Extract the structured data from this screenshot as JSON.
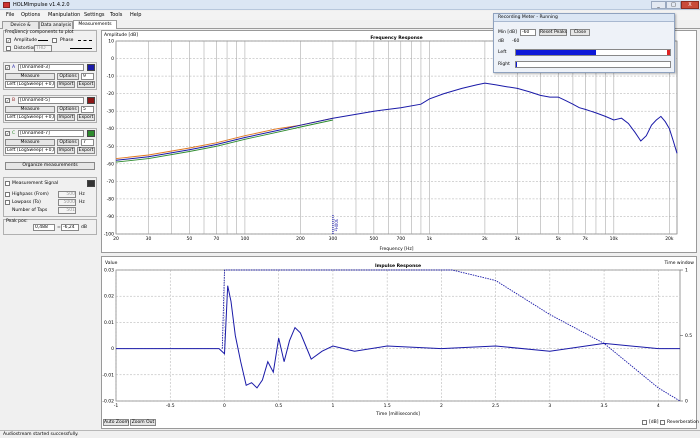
{
  "app": {
    "title": "HOLMImpulse v1.4.2.0",
    "win_min": "_",
    "win_max": "□",
    "win_close": "X"
  },
  "menu": [
    "File",
    "Options",
    "Manipulation",
    "Settings",
    "Tools",
    "Help"
  ],
  "tabs": [
    "Device & Signal",
    "Data analysis",
    "Measurements"
  ],
  "left": {
    "freq_group_title": "Frequency components to plot",
    "amplitude": "Amplitude",
    "phase": "Phase",
    "distortion": "Distortion",
    "thd": "THD",
    "measurements": [
      {
        "letter": "A",
        "name": "[Unnamed-3]",
        "measure": "Measure",
        "options": "Options",
        "num": "9",
        "range": "Left (LogSweep) +0,0dB",
        "import": "Import",
        "export": "Export",
        "color": "#1a1aa8"
      },
      {
        "letter": "B",
        "name": "[Unnamed-5]",
        "measure": "Measure",
        "options": "Options",
        "num": "5",
        "range": "Left (LogSweep) +0,0dB",
        "import": "Import",
        "export": "Export",
        "color": "#8b1616"
      },
      {
        "letter": "C",
        "name": "[Unnamed-7]",
        "measure": "Measure",
        "options": "Options",
        "num": "7",
        "range": "Left (LogSweep) +0,0dB",
        "import": "Import",
        "export": "Export",
        "color": "#2e8b2e"
      }
    ],
    "organize": "Organize measurements",
    "meas_signal": "Measurement Signal",
    "highpass": "Highpass (From)",
    "highpass_val": "500",
    "lowpass": "Lowpass (To)",
    "lowpass_val": "5000",
    "taps": "Number of Taps",
    "taps_val": "501",
    "hz": "Hz",
    "peak_title": "Peak pos:",
    "peak_time": "0,488",
    "peak_db": "-6,24",
    "peak_unit": "dB"
  },
  "freq_chart": {
    "title": "Frequency Response",
    "ylabel": "Amplitude [dB]",
    "xlabel": "Frequency [Hz]",
    "marker": "300Hz"
  },
  "imp_chart": {
    "title": "Impulse Response",
    "ylabel": "Value",
    "y2label": "Time window",
    "xlabel": "Time [milliseconds]",
    "auto_zoom": "Auto Zoom",
    "zoom_out": "Zoom Out",
    "db": "[dB]",
    "reverb": "Reverberation"
  },
  "recording_meter": {
    "title": "Recording Meter - Running",
    "min_label": "Min [dB]",
    "min_val": "-60",
    "reset": "Reset Peaks",
    "close": "Close",
    "db_label": "dB",
    "db_scale": "-60",
    "left": "Left",
    "right": "Right",
    "left_level": 0.52
  },
  "status": "Audiostream started successfully.",
  "chart_data": [
    {
      "type": "line",
      "title": "Frequency Response",
      "xlabel": "Frequency [Hz]",
      "ylabel": "Amplitude [dB]",
      "xscale": "log",
      "xlim": [
        20,
        22000
      ],
      "ylim": [
        -100,
        10
      ],
      "xticks": [
        20,
        30,
        50,
        70,
        100,
        200,
        300,
        500,
        700,
        1000,
        2000,
        3000,
        5000,
        7000,
        10000,
        20000
      ],
      "xticklabels": [
        "20",
        "30",
        "50",
        "70",
        "100",
        "200",
        "300",
        "500",
        "700",
        "1k",
        "2k",
        "3k",
        "5k",
        "7k",
        "10k",
        "20k"
      ],
      "yticks": [
        10,
        0,
        -10,
        -20,
        -30,
        -40,
        -50,
        -60,
        -70,
        -80,
        -90,
        -100
      ],
      "series": [
        {
          "color": "#1a1aa8",
          "x": [
            20,
            30,
            50,
            70,
            100,
            150,
            200,
            300,
            500,
            700,
            900,
            1000,
            1200,
            1500,
            1800,
            2000,
            2300,
            2600,
            3000,
            3500,
            4000,
            4500,
            5000,
            5500,
            6000,
            6500,
            7000,
            7500,
            8000,
            9000,
            10000,
            11000,
            12000,
            13000,
            14000,
            15000,
            16000,
            17000,
            18000,
            19000,
            20000,
            21000,
            22000
          ],
          "y": [
            -58,
            -56,
            -52,
            -49,
            -45,
            -41,
            -38,
            -34,
            -30,
            -28,
            -26,
            -23,
            -20,
            -17,
            -15,
            -14,
            -15,
            -16,
            -17,
            -19,
            -21,
            -22,
            -22,
            -24,
            -26,
            -28,
            -29,
            -30,
            -31,
            -33,
            -35,
            -34,
            -37,
            -42,
            -47,
            -44,
            -38,
            -35,
            -33,
            -36,
            -40,
            -47,
            -54
          ]
        },
        {
          "color": "#e07820",
          "x": [
            20,
            30,
            50,
            70,
            100,
            150,
            200,
            300
          ],
          "y": [
            -57,
            -55,
            -51,
            -48,
            -44,
            -40,
            -38,
            -34
          ]
        },
        {
          "color": "#2e8b2e",
          "x": [
            20,
            30,
            50,
            70,
            100,
            150,
            200,
            300
          ],
          "y": [
            -59,
            -57,
            -53,
            -50,
            -46,
            -42,
            -39,
            -35
          ]
        }
      ]
    },
    {
      "type": "line",
      "title": "Impulse Response",
      "xlabel": "Time [milliseconds]",
      "ylabel": "Value",
      "xlim": [
        -1,
        4.2
      ],
      "ylim": [
        -0.02,
        0.03
      ],
      "xticks": [
        -1,
        -0.5,
        0,
        0.5,
        1,
        1.5,
        2,
        2.5,
        3,
        3.5,
        4
      ],
      "yticks": [
        0.03,
        0.02,
        0.01,
        0,
        -0.01,
        -0.02
      ],
      "y2ticks": [
        1,
        0.5,
        0
      ],
      "series": [
        {
          "name": "impulse",
          "color": "#1a1aa8",
          "x": [
            -1,
            -0.2,
            -0.05,
            0,
            0.03,
            0.06,
            0.1,
            0.15,
            0.2,
            0.25,
            0.3,
            0.35,
            0.4,
            0.45,
            0.5,
            0.55,
            0.6,
            0.65,
            0.7,
            0.75,
            0.8,
            0.9,
            1,
            1.2,
            1.5,
            2,
            2.5,
            3,
            3.5,
            4,
            4.2
          ],
          "y": [
            0,
            0,
            0,
            -0.002,
            0.024,
            0.018,
            0.005,
            -0.005,
            -0.014,
            -0.013,
            -0.015,
            -0.012,
            -0.005,
            -0.009,
            0.004,
            -0.005,
            0.003,
            0.008,
            0.006,
            0.001,
            -0.004,
            -0.001,
            0.001,
            -0.001,
            0.001,
            0,
            0.001,
            -0.001,
            0.002,
            0,
            0
          ]
        },
        {
          "name": "window",
          "color": "#1a1aa8",
          "dashed": true,
          "x": [
            -0.02,
            0,
            2.1,
            2.5,
            3,
            3.5,
            4,
            4.2
          ],
          "y": [
            0,
            0.03,
            0.03,
            0.026,
            0.013,
            0.002,
            -0.015,
            -0.02
          ]
        }
      ]
    }
  ]
}
